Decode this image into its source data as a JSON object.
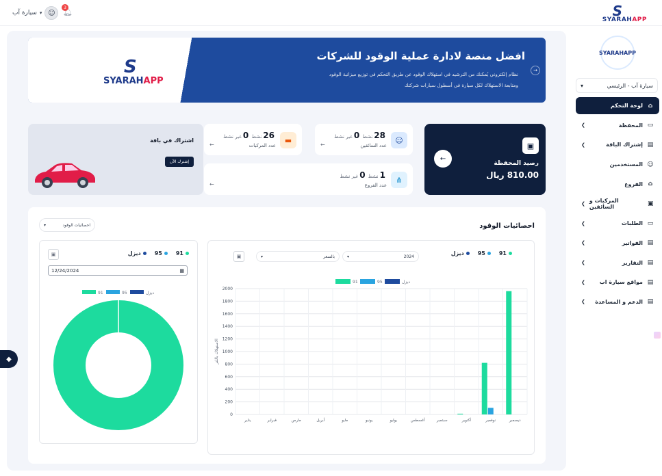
{
  "topbar": {
    "brand": {
      "s": "S",
      "t1": "SYARAH",
      "t2": "APP"
    },
    "user_name": "سيارة آب",
    "notif_count": "3"
  },
  "sidebar": {
    "logo": "SYARAHAPP",
    "account_select": "سيارة آب - الرئيسي",
    "items": [
      {
        "label": "لوحة التحكم",
        "icon": "home-icon",
        "glyph": "⌂",
        "chevron": false
      },
      {
        "label": "المحفظة",
        "icon": "wallet-icon",
        "glyph": "▭",
        "chevron": true
      },
      {
        "label": "إشتراك الباقة",
        "icon": "document-icon",
        "glyph": "▤",
        "chevron": true
      },
      {
        "label": "المستخدمين",
        "icon": "users-icon",
        "glyph": "☺",
        "chevron": false
      },
      {
        "label": "الفروع",
        "icon": "branch-icon",
        "glyph": "⌂",
        "chevron": false
      },
      {
        "label": "المركبات و السائقين",
        "icon": "car-icon",
        "glyph": "▣",
        "chevron": true
      },
      {
        "label": "الطلبات",
        "icon": "truck-icon",
        "glyph": "▭",
        "chevron": true
      },
      {
        "label": "الفواتير",
        "icon": "invoice-icon",
        "glyph": "▤",
        "chevron": true
      },
      {
        "label": "التقارير",
        "icon": "report-icon",
        "glyph": "▤",
        "chevron": true
      },
      {
        "label": "مواقع سيارة اب",
        "icon": "location-icon",
        "glyph": "▤",
        "chevron": true
      },
      {
        "label": "الدعم و المساعدة",
        "icon": "support-icon",
        "glyph": "▤",
        "chevron": true
      }
    ]
  },
  "banner": {
    "title": "افضل منصة لادارة عملية الوقود للشركات",
    "line1": "نظام إلكتروني يُمكنك من الترشيد في استهلاك الوقود عن طريق التحكم في توزيع ميزانية الوقود",
    "line2": "ومتابعة الاستهلاك لكل سيارة في أسطول سيارات شركتك",
    "logo_s": "S",
    "logo_t1": "SYARAH",
    "logo_t2": "APP"
  },
  "wallet": {
    "label": "رصيد المحفظة",
    "value": "810.00 ريال",
    "accent": "#0f1f3d"
  },
  "stats": {
    "drivers": {
      "active": "28",
      "active_label": "نشط",
      "inactive": "0",
      "inactive_label": "غير نشط",
      "caption": "عدد السائقين"
    },
    "vehicles": {
      "active": "26",
      "active_label": "نشط",
      "inactive": "0",
      "inactive_label": "غير نشط",
      "caption": "عدد المركبات"
    },
    "branches": {
      "active": "1",
      "active_label": "نشط",
      "inactive": "0",
      "inactive_label": "غير نشط",
      "caption": "عدد الفروع"
    }
  },
  "promo": {
    "title": "اشتراك في باقة",
    "button": "إشترك الآن"
  },
  "fuel_stats": {
    "title": "احصائيات الوقود",
    "select": "احصائيات الوقود",
    "legend_91": "91",
    "legend_95": "95",
    "legend_diesel": "ديزل",
    "year": "2024",
    "unit": "بالسعر",
    "date": "12/24/2024"
  },
  "colors": {
    "g91": "#1ddb9e",
    "g95": "#2aa4e0",
    "diesel": "#1e4b9e",
    "navy": "#0f1f3d"
  },
  "chart_data": [
    {
      "type": "bar",
      "ylabel": "الاستهلاك باللتر",
      "ylim": [
        0,
        2000
      ],
      "yticks": [
        0,
        200,
        400,
        600,
        800,
        1000,
        1200,
        1400,
        1600,
        1800,
        2000
      ],
      "categories": [
        "يناير",
        "فبراير",
        "مارس",
        "أبريل",
        "مايو",
        "يونيو",
        "يوليو",
        "أغسطس",
        "سبتمبر",
        "أكتوبر",
        "نوفمبر",
        "ديسمبر"
      ],
      "series": [
        {
          "name": "91",
          "color": "#1ddb9e",
          "values": [
            0,
            0,
            0,
            0,
            0,
            0,
            0,
            0,
            0,
            12,
            820,
            1960
          ]
        },
        {
          "name": "95",
          "color": "#2aa4e0",
          "values": [
            0,
            0,
            0,
            0,
            0,
            0,
            0,
            0,
            0,
            0,
            105,
            0
          ]
        },
        {
          "name": "ديزل",
          "color": "#1e4b9e",
          "values": [
            0,
            0,
            0,
            0,
            0,
            0,
            0,
            0,
            0,
            0,
            0,
            0
          ]
        }
      ]
    },
    {
      "type": "pie",
      "donut": true,
      "slices": [
        {
          "name": "91",
          "color": "#1ddb9e",
          "value": 100
        },
        {
          "name": "95",
          "color": "#2aa4e0",
          "value": 0
        },
        {
          "name": "ديزل",
          "color": "#1e4b9e",
          "value": 0
        }
      ]
    }
  ]
}
